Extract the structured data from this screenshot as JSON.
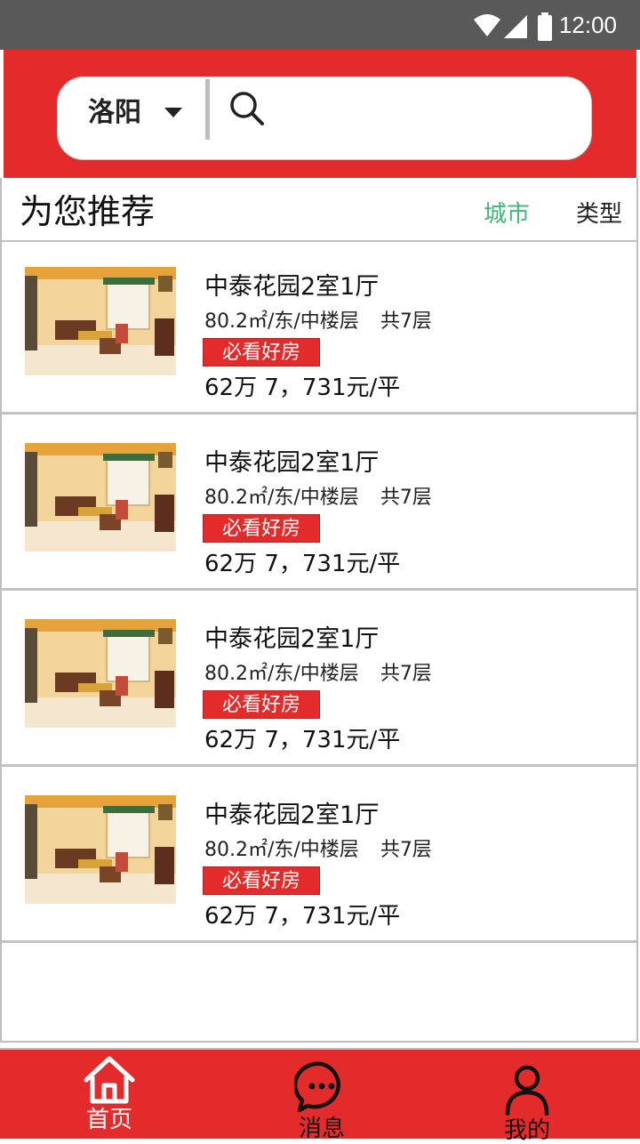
{
  "status_bar": {
    "time": "12:00",
    "icons": [
      "wifi-icon",
      "signal-icon",
      "battery-icon"
    ]
  },
  "header": {
    "city": "洛阳",
    "search_placeholder": "",
    "colors": {
      "brand": "#e32b2c"
    }
  },
  "section": {
    "title": "为您推荐",
    "filters": [
      {
        "label": "城市",
        "active": true,
        "color": "#3cb878"
      },
      {
        "label": "类型",
        "active": false
      }
    ]
  },
  "listings": [
    {
      "title": "中泰花园2室1厅",
      "info": "80.2㎡/东/中楼层",
      "floors": "共7层",
      "badge": "必看好房",
      "price": "62万 7，731元/平"
    },
    {
      "title": "中泰花园2室1厅",
      "info": "80.2㎡/东/中楼层",
      "floors": "共7层",
      "badge": "必看好房",
      "price": "62万 7，731元/平"
    },
    {
      "title": "中泰花园2室1厅",
      "info": "80.2㎡/东/中楼层",
      "floors": "共7层",
      "badge": "必看好房",
      "price": "62万 7，731元/平"
    },
    {
      "title": "中泰花园2室1厅",
      "info": "80.2㎡/东/中楼层",
      "floors": "共7层",
      "badge": "必看好房",
      "price": "62万 7，731元/平"
    }
  ],
  "bottom_nav": [
    {
      "label": "首页",
      "icon": "home-icon",
      "active": true
    },
    {
      "label": "消息",
      "icon": "chat-bubble-icon",
      "active": false
    },
    {
      "label": "我的",
      "icon": "user-icon",
      "active": false
    }
  ]
}
